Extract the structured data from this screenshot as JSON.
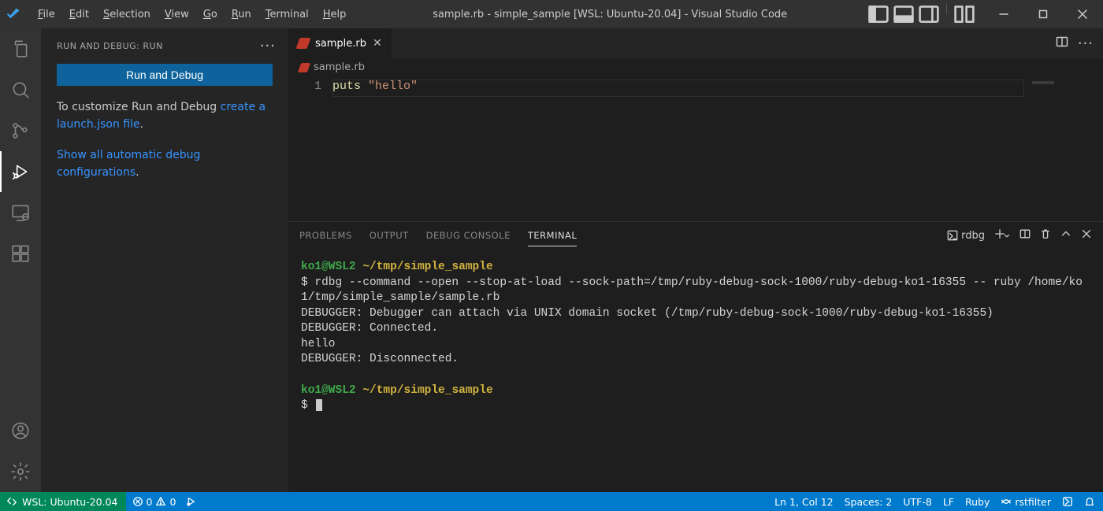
{
  "menu": {
    "items": [
      "File",
      "Edit",
      "Selection",
      "View",
      "Go",
      "Run",
      "Terminal",
      "Help"
    ]
  },
  "title": "sample.rb - simple_sample [WSL: Ubuntu-20.04] - Visual Studio Code",
  "sidebar": {
    "header": "RUN AND DEBUG: RUN",
    "run_button": "Run and Debug",
    "customize_pre": "To customize Run and Debug ",
    "customize_link": "create a launch.json file",
    "show_all_link": "Show all automatic debug configurations",
    "period": "."
  },
  "editor": {
    "tab": "sample.rb",
    "breadcrumb": "sample.rb",
    "line_no": "1",
    "code_kw": "puts",
    "code_sp": " ",
    "code_str": "\"hello\""
  },
  "panel": {
    "tabs": [
      "PROBLEMS",
      "OUTPUT",
      "DEBUG CONSOLE",
      "TERMINAL"
    ],
    "profile": "rdbg",
    "term": {
      "prompt1_user": "ko1@WSL2",
      "prompt1_path": "~/tmp/simple_sample",
      "cmd_line": "$ rdbg --command --open --stop-at-load --sock-path=/tmp/ruby-debug-sock-1000/ruby-debug-ko1-16355 -- ruby /home/ko1/tmp/simple_sample/sample.rb",
      "l1": "DEBUGGER: Debugger can attach via UNIX domain socket (/tmp/ruby-debug-sock-1000/ruby-debug-ko1-16355)",
      "l2": "DEBUGGER: Connected.",
      "l3": "hello",
      "l4": "DEBUGGER: Disconnected.",
      "prompt2_user": "ko1@WSL2",
      "prompt2_path": "~/tmp/simple_sample",
      "dollar": "$"
    }
  },
  "status": {
    "remote": "WSL: Ubuntu-20.04",
    "err": "0",
    "warn": "0",
    "ln_col": "Ln 1, Col 12",
    "spaces": "Spaces: 2",
    "encoding": "UTF-8",
    "eol": "LF",
    "lang": "Ruby",
    "ext": "rstfilter"
  }
}
